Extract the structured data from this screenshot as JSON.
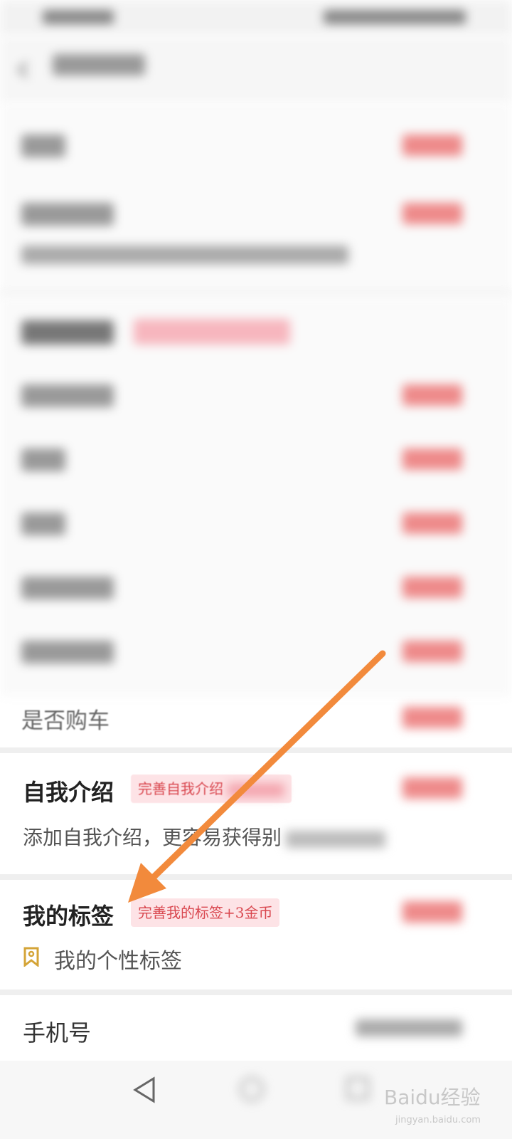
{
  "profile": {
    "is_car_owner_label": "是否购车",
    "self_intro": {
      "title": "自我介绍",
      "badge": "完善自我介绍",
      "hint": "添加自我介绍，更容易获得别"
    },
    "my_tags": {
      "title": "我的标签",
      "badge": "完善我的标签+3金币",
      "personal_tags": "我的个性标签"
    },
    "phone": {
      "label": "手机号"
    }
  },
  "watermark": {
    "brand": "Baidu经验",
    "sub": "jingyan.baidu.com"
  },
  "colors": {
    "accent_red": "#e45a5a",
    "badge_bg": "#fde3e6",
    "arrow": "#f28a3c",
    "tag_icon": "#d4a437"
  }
}
